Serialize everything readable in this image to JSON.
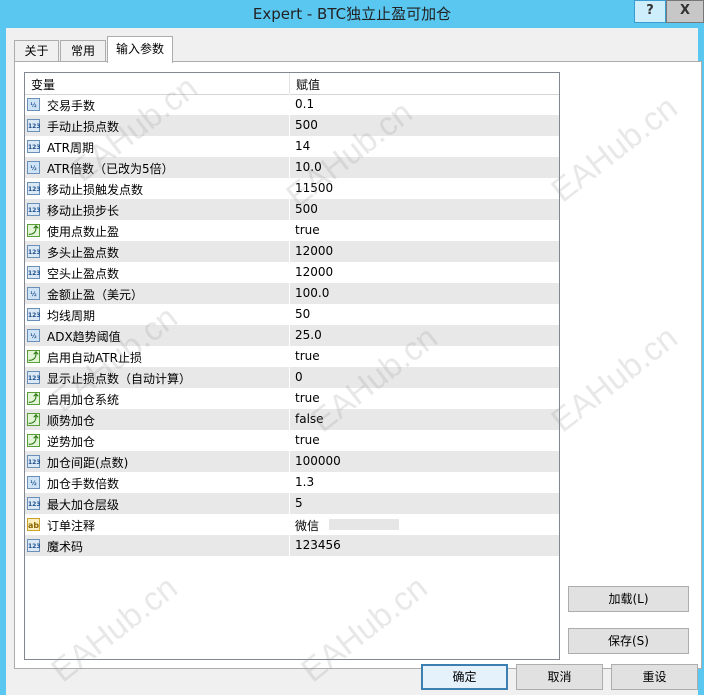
{
  "window": {
    "title": "Expert - BTC独立止盈可加仓",
    "help_label": "?",
    "close_label": "X"
  },
  "tabs": [
    {
      "label": "关于"
    },
    {
      "label": "常用"
    },
    {
      "label": "输入参数",
      "active": true
    }
  ],
  "table": {
    "headers": {
      "variable": "变量",
      "value": "赋值"
    },
    "rows": [
      {
        "icon": "float-icon",
        "glyph": "½",
        "name": "交易手数",
        "value": "0.1"
      },
      {
        "icon": "integer-icon",
        "glyph": "123",
        "name": "手动止损点数",
        "value": "500"
      },
      {
        "icon": "integer-icon",
        "glyph": "123",
        "name": "ATR周期",
        "value": "14"
      },
      {
        "icon": "float-icon",
        "glyph": "½",
        "name": "ATR倍数（已改为5倍）",
        "value": "10.0"
      },
      {
        "icon": "integer-icon",
        "glyph": "123",
        "name": "移动止损触发点数",
        "value": "11500"
      },
      {
        "icon": "integer-icon",
        "glyph": "123",
        "name": "移动止损步长",
        "value": "500"
      },
      {
        "icon": "bool-icon",
        "glyph": "⤴",
        "name": "使用点数止盈",
        "value": "true"
      },
      {
        "icon": "integer-icon",
        "glyph": "123",
        "name": "多头止盈点数",
        "value": "12000"
      },
      {
        "icon": "integer-icon",
        "glyph": "123",
        "name": "空头止盈点数",
        "value": "12000"
      },
      {
        "icon": "float-icon",
        "glyph": "½",
        "name": "金额止盈（美元）",
        "value": "100.0"
      },
      {
        "icon": "integer-icon",
        "glyph": "123",
        "name": "均线周期",
        "value": "50"
      },
      {
        "icon": "float-icon",
        "glyph": "½",
        "name": "ADX趋势阈值",
        "value": "25.0"
      },
      {
        "icon": "bool-icon",
        "glyph": "⤴",
        "name": "启用自动ATR止损",
        "value": "true"
      },
      {
        "icon": "integer-icon",
        "glyph": "123",
        "name": "显示止损点数（自动计算）",
        "value": "0"
      },
      {
        "icon": "bool-icon",
        "glyph": "⤴",
        "name": "启用加仓系统",
        "value": "true"
      },
      {
        "icon": "bool-icon",
        "glyph": "⤴",
        "name": "顺势加仓",
        "value": "false"
      },
      {
        "icon": "bool-icon",
        "glyph": "⤴",
        "name": "逆势加仓",
        "value": "true"
      },
      {
        "icon": "integer-icon",
        "glyph": "123",
        "name": "加仓间距(点数)",
        "value": "100000"
      },
      {
        "icon": "float-icon",
        "glyph": "½",
        "name": "加仓手数倍数",
        "value": "1.3"
      },
      {
        "icon": "integer-icon",
        "glyph": "123",
        "name": "最大加仓层级",
        "value": "5"
      },
      {
        "icon": "string-icon",
        "glyph": "ab",
        "name": "订单注释",
        "value": "微信",
        "redacted": true
      },
      {
        "icon": "integer-icon",
        "glyph": "123",
        "name": "魔术码",
        "value": "123456"
      }
    ]
  },
  "buttons": {
    "load": "加载(L)",
    "save": "保存(S)",
    "ok": "确定",
    "cancel": "取消",
    "reset": "重设"
  },
  "watermark": "EAHub.cn"
}
